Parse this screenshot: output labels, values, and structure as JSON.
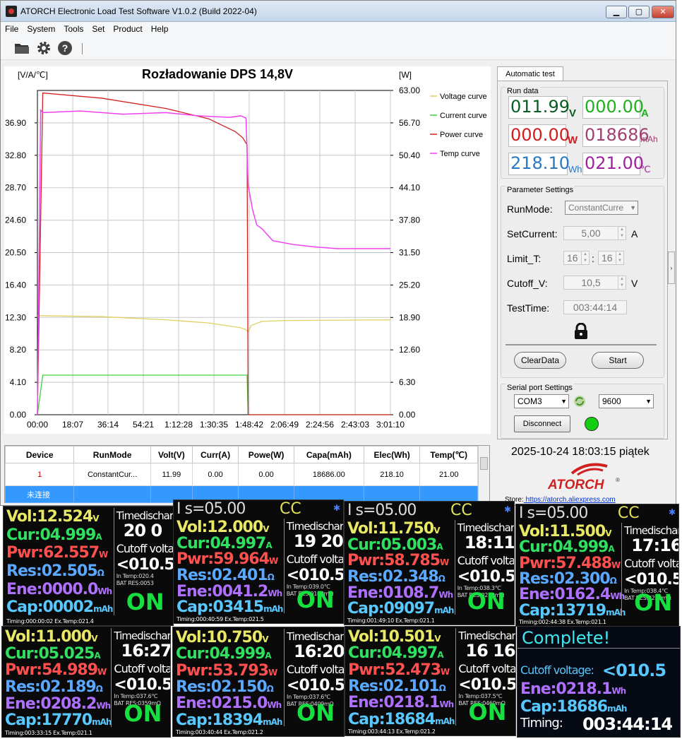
{
  "window": {
    "title": "ATORCH Electronic Load Test Software V1.0.2 (Build 2022-04)",
    "min": "▁",
    "max": "▢",
    "close": "✕"
  },
  "menu": [
    "File",
    "System",
    "Tools",
    "Set",
    "Product",
    "Help"
  ],
  "toolbar": {
    "icons": [
      "folder-icon",
      "gear-icon",
      "help-icon"
    ]
  },
  "chart": {
    "title": "Rozładowanie DPS 14,8V",
    "left_axis_label": "[V/A/℃]",
    "right_axis_label": "[W]"
  },
  "chart_data": {
    "type": "line",
    "title": "Rozładowanie DPS 14,8V",
    "ylabel_left": "[V/A/℃]",
    "ylabel_right": "[W]",
    "ylim_left": [
      0,
      41
    ],
    "ylim_right": [
      0,
      63
    ],
    "left_ticks": [
      "0.00",
      "4.10",
      "8.20",
      "12.30",
      "16.40",
      "20.50",
      "24.60",
      "28.70",
      "32.80",
      "36.90"
    ],
    "right_ticks": [
      "0.00",
      "6.30",
      "12.60",
      "18.90",
      "25.20",
      "31.50",
      "37.80",
      "44.10",
      "50.40",
      "56.70",
      "63.00"
    ],
    "x_ticks": [
      "00:00",
      "18:07",
      "36:14",
      "54:21",
      "1:12:28",
      "1:30:35",
      "1:48:42",
      "2:06:49",
      "2:24:56",
      "2:43:03",
      "3:01:10"
    ],
    "grid": true,
    "legend_position": "right",
    "series": [
      {
        "name": "Voltage curve",
        "axis": "left",
        "color": "#e0d060",
        "x": [
          0,
          60,
          120,
          160,
          190,
          195,
          197,
          200,
          210,
          230,
          270,
          330
        ],
        "y": [
          12.52,
          12.4,
          12.0,
          11.6,
          11.0,
          10.75,
          10.5,
          11.3,
          11.8,
          11.9,
          11.95,
          11.99
        ]
      },
      {
        "name": "Current curve",
        "axis": "left",
        "color": "#40d040",
        "x": [
          0,
          5,
          196,
          197,
          330
        ],
        "y": [
          0,
          5.0,
          5.0,
          0,
          0
        ]
      },
      {
        "name": "Power curve",
        "axis": "right",
        "color": "#d02020",
        "x": [
          0,
          5,
          60,
          120,
          160,
          185,
          192,
          196,
          197,
          330
        ],
        "y": [
          0,
          62.5,
          61.5,
          59.5,
          57.5,
          55.0,
          53.8,
          52.4,
          0,
          0
        ]
      },
      {
        "name": "Temp curve",
        "axis": "left",
        "color": "#f040f0",
        "x": [
          0,
          3,
          5,
          40,
          80,
          120,
          150,
          180,
          190,
          195,
          197,
          199,
          201,
          205,
          210,
          220,
          240,
          260,
          280,
          300,
          330
        ],
        "y": [
          0,
          38.5,
          38.2,
          38.4,
          38.0,
          38.2,
          37.8,
          37.6,
          37.8,
          37.5,
          29.0,
          27.5,
          26.0,
          24.0,
          23.5,
          22.0,
          21.5,
          21.2,
          21.0,
          21.0,
          21.0
        ]
      }
    ]
  },
  "automatic_tab": "Automatic test",
  "run_data": {
    "title": "Run data",
    "voltage": "011.99",
    "voltage_unit": "V",
    "current": "000.00",
    "current_unit": "A",
    "power": "000.00",
    "power_unit": "W",
    "capacity": "018686",
    "capacity_unit": "mAh",
    "energy": "218.10",
    "energy_unit": "Wh",
    "temp": "021.00",
    "temp_unit": "℃"
  },
  "params": {
    "title": "Parameter Settings",
    "runmode_label": "RunMode:",
    "runmode_value": "ConstantCurre",
    "setcurrent_label": "SetCurrent:",
    "setcurrent_value": "5,00",
    "setcurrent_unit": "A",
    "limit_label": "Limit_T:",
    "limit_h": "16",
    "limit_m": "16",
    "limit_sep": ":",
    "cutoff_label": "Cutoff_V:",
    "cutoff_value": "10,5",
    "cutoff_unit": "V",
    "testtime_label": "TestTime:",
    "testtime_value": "003:44:14",
    "clear_btn": "ClearData",
    "start_btn": "Start"
  },
  "serial": {
    "title": "Serial port Settings",
    "port": "COM3",
    "baud": "9600",
    "disconnect_btn": "Disconnect",
    "status_color": "#10d010"
  },
  "table": {
    "headers": [
      "Device",
      "RunMode",
      "Volt(V)",
      "Curr(A)",
      "Powe(W)",
      "Capa(mAh)",
      "Elec(Wh)",
      "Temp(℃)"
    ],
    "rows": [
      [
        "1",
        "ConstantCur...",
        "11.99",
        "0.00",
        "0.00",
        "18686.00",
        "218.10",
        "21.00"
      ],
      [
        "未连接",
        "",
        "",
        "",
        "",
        "",
        "",
        ""
      ]
    ]
  },
  "datetime": "2025-10-24 18:03:15 piątek",
  "brand": "ATORCH",
  "store": {
    "label": "Store:",
    "url": " https://atorch.aliexpress.com"
  },
  "photos": [
    {
      "header": "",
      "vol": "12.524",
      "cur": "04.999",
      "pwr": "62.557",
      "res": "02.505",
      "ene": "0000.0",
      "cap": "00002",
      "time_label": "Timedischarge",
      "time": "20 0",
      "cutoff_label": "Cutoff voltag",
      "cutoff": "<010.5",
      "intemp": "In Temp:020.4",
      "batres": "BAT RES:0053",
      "timing": "Timing:000:00:02 Ex.Temp:021.4"
    },
    {
      "header": "I s=05.00",
      "vol": "12.000",
      "cur": "04.997",
      "pwr": "59.964",
      "res": "02.401",
      "ene": "0041.2",
      "cap": "03415",
      "time_label": "Timedischarge",
      "time": "19 20",
      "cutoff_label": "Cutoff voltage",
      "cutoff": "<010.5",
      "intemp": "In Temp:039.0℃",
      "batres": "BAT RES:0160mΩ",
      "timing": "Timing:000:40:59 Ex.Temp:021.5"
    },
    {
      "header": "I s=05.00",
      "vol": "11.750",
      "cur": "05.003",
      "pwr": "58.785",
      "res": "02.348",
      "ene": "0108.7",
      "cap": "09097",
      "time_label": "Timedischarge",
      "time": "18:11",
      "cutoff_label": "Cutoff voltage",
      "cutoff": "<010.5",
      "intemp": "In Temp:038.3℃",
      "batres": "BAT RES:0210mΩ",
      "timing": "Timing:001:49:10 Ex.Temp:021.1"
    },
    {
      "header": "I s=05.00",
      "vol": "11.500",
      "cur": "04.999",
      "pwr": "57.488",
      "res": "02.300",
      "ene": "0162.4",
      "cap": "13719",
      "time_label": "Timedischarge",
      "time": "17:16",
      "cutoff_label": "Cutoff voltage",
      "cutoff": "<010.5",
      "intemp": "In Temp:038.4℃",
      "batres": "BAT RES:0259mΩ",
      "timing": "Timing:002:44:38 Ex.Temp:021.1"
    },
    {
      "header": "",
      "vol": "11.000",
      "cur": "05.025",
      "pwr": "54.989",
      "res": "02.189",
      "ene": "0208.2",
      "cap": "17770",
      "time_label": "Timedischarge",
      "time": "16:27",
      "cutoff_label": "Cutoff voltage",
      "cutoff": "<010.5",
      "intemp": "In Temp:037.6℃",
      "batres": "BAT RES:0359mΩ",
      "timing": "Timing:003:33:15 Ex.Temp:021.1"
    },
    {
      "header": "",
      "vol": "10.750",
      "cur": "04.999",
      "pwr": "53.793",
      "res": "02.150",
      "ene": "0215.0",
      "cap": "18394",
      "time_label": "Timedischarge",
      "time": "16:20",
      "cutoff_label": "Cutoff voltage",
      "cutoff": "<010.5",
      "intemp": "In Temp:037.6℃",
      "batres": "BAT RES:0409mΩ",
      "timing": "Timing:003:40:44 Ex.Temp:021.2"
    },
    {
      "header": "",
      "vol": "10.501",
      "cur": "04.997",
      "pwr": "52.473",
      "res": "02.101",
      "ene": "0218.1",
      "cap": "18684",
      "time_label": "Timedischarge",
      "time": "16 16",
      "cutoff_label": "Cutoff voltage",
      "cutoff": "<010.5",
      "intemp": "In Temp:037.5℃",
      "batres": "BAT RES:0460mΩ",
      "timing": "Timing:003:44:13 Ex.Temp:021.2"
    }
  ],
  "complete": {
    "title": "Complete!",
    "cutoff_label": "Cutoff voltage:",
    "cutoff": "<010.5",
    "ene": "0218.1",
    "cap": "18686",
    "timing_label": "Timing:",
    "timing": "003:44:14"
  },
  "labels": {
    "vol": "Vol:",
    "cur": "Cur:",
    "pwr": "Pwr:",
    "res": "Res:",
    "ene": "Ene:",
    "cap": "Cap:",
    "cc": "CC",
    "on": "ON",
    "u_v": "V",
    "u_a": "A",
    "u_w": "W",
    "u_ohm": "Ω",
    "u_wh": "Wh",
    "u_mah": "mAh"
  }
}
